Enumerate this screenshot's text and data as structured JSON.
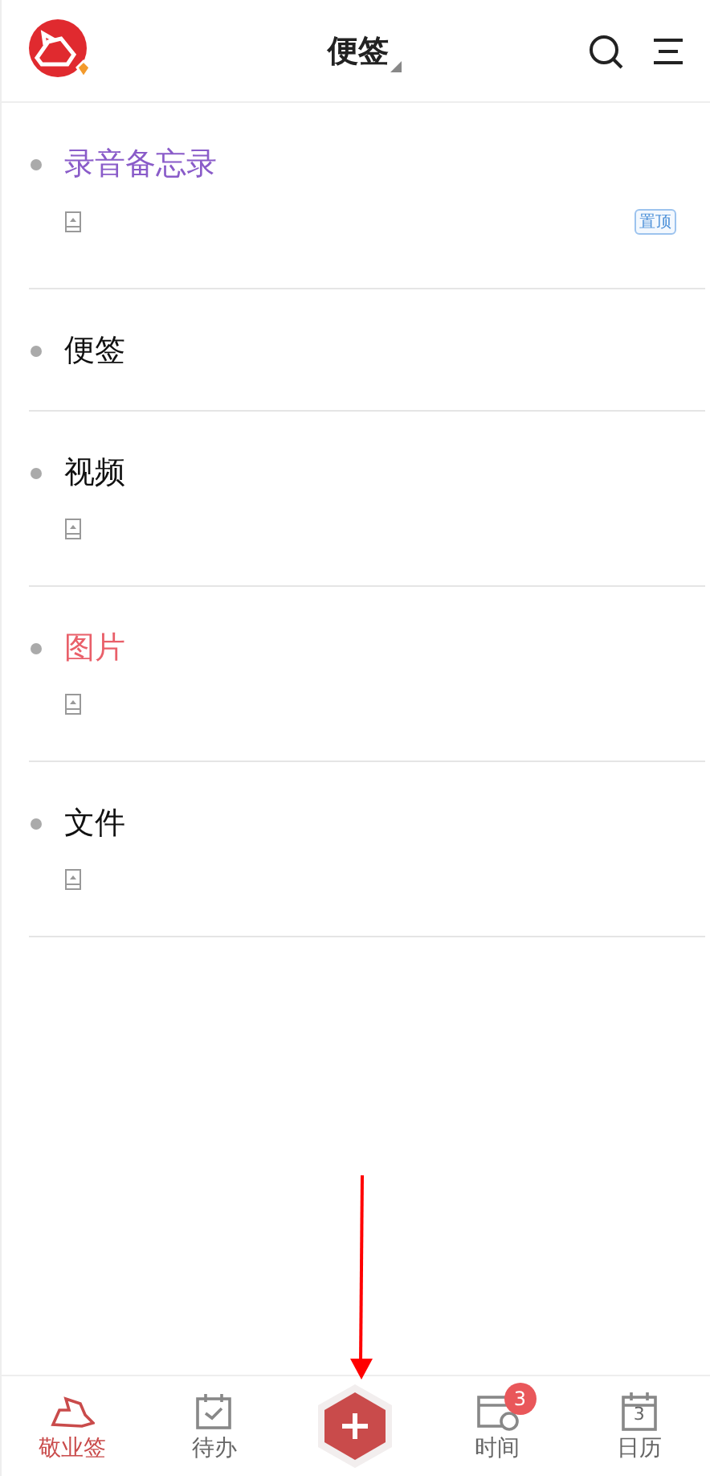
{
  "header": {
    "title": "便签"
  },
  "notes": [
    {
      "title": "录音备忘录",
      "color": "#8a5cc9",
      "attachment": true,
      "tag": "置顶"
    },
    {
      "title": "便签",
      "color": "#111111",
      "attachment": false
    },
    {
      "title": "视频",
      "color": "#111111",
      "attachment": true
    },
    {
      "title": "图片",
      "color": "#e9606a",
      "attachment": true
    },
    {
      "title": "文件",
      "color": "#111111",
      "attachment": true
    }
  ],
  "tabbar": [
    {
      "kind": "notes",
      "label": "敬业签",
      "selected": true
    },
    {
      "kind": "todo",
      "label": "待办",
      "selected": false
    },
    {
      "kind": "add"
    },
    {
      "kind": "time",
      "label": "时间",
      "selected": false,
      "badge": "3"
    },
    {
      "kind": "calendar",
      "label": "日历",
      "selected": false,
      "icon_text": "3"
    }
  ]
}
